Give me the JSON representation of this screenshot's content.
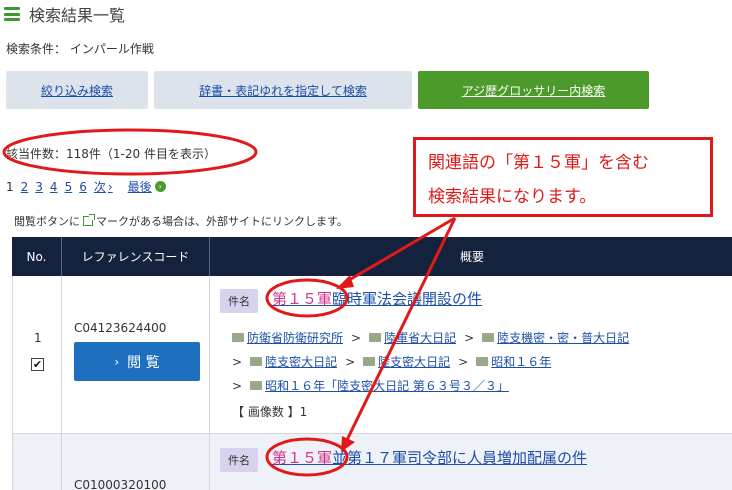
{
  "header": {
    "title": "検索結果一覧"
  },
  "conditions": {
    "text": "検索条件： インパール作戦"
  },
  "tabs": [
    {
      "label": "絞り込み検索"
    },
    {
      "label": "辞書・表記ゆれを指定して検索"
    },
    {
      "label": "アジ歴グロッサリー内検索"
    }
  ],
  "results": {
    "count_text": "該当件数：118件（1-20 件目を表示）"
  },
  "pager": {
    "current": "1",
    "pages": [
      "2",
      "3",
      "4",
      "5",
      "6"
    ],
    "next": "次",
    "last": "最後",
    "next_arrow": "›",
    "last_arrow": "›"
  },
  "note": {
    "before": "閲覧ボタンに",
    "after": "マークがある場合は、外部サイトにリンクします。"
  },
  "table": {
    "headers": {
      "no": "No.",
      "ref": "レファレンスコード",
      "summary": "概要"
    },
    "rows": [
      {
        "no": "1",
        "checked": "✔",
        "ref": "C04123624400",
        "view_label": "閲 覧",
        "badge": "件名",
        "title_highlight": "第１５軍",
        "title_rest": "臨時軍法会議開設の件",
        "crumbs": [
          "防衛省防衛研究所",
          "陸軍省大日記",
          "陸支機密・密・普大日記",
          "陸支密大日記",
          "陸支密大日記",
          "昭和１６年",
          "昭和１６年「陸支密大日記 第６３号３／３」"
        ],
        "images": "【 画像数 】1"
      },
      {
        "ref": "C01000320100",
        "badge": "件名",
        "title_highlight": "第１５軍",
        "title_rest": "並第１７軍司令部に人員増加配属の件"
      }
    ]
  },
  "callout": {
    "line1": "関連語の「第１５軍」を含む",
    "line2": "検索結果になります。"
  },
  "colors": {
    "accent_green": "#4c9a2a",
    "header_navy": "#15223d",
    "link_blue": "#1d4fa8",
    "highlight_pink": "#d6338a",
    "annotation_red": "#e01a1a"
  }
}
